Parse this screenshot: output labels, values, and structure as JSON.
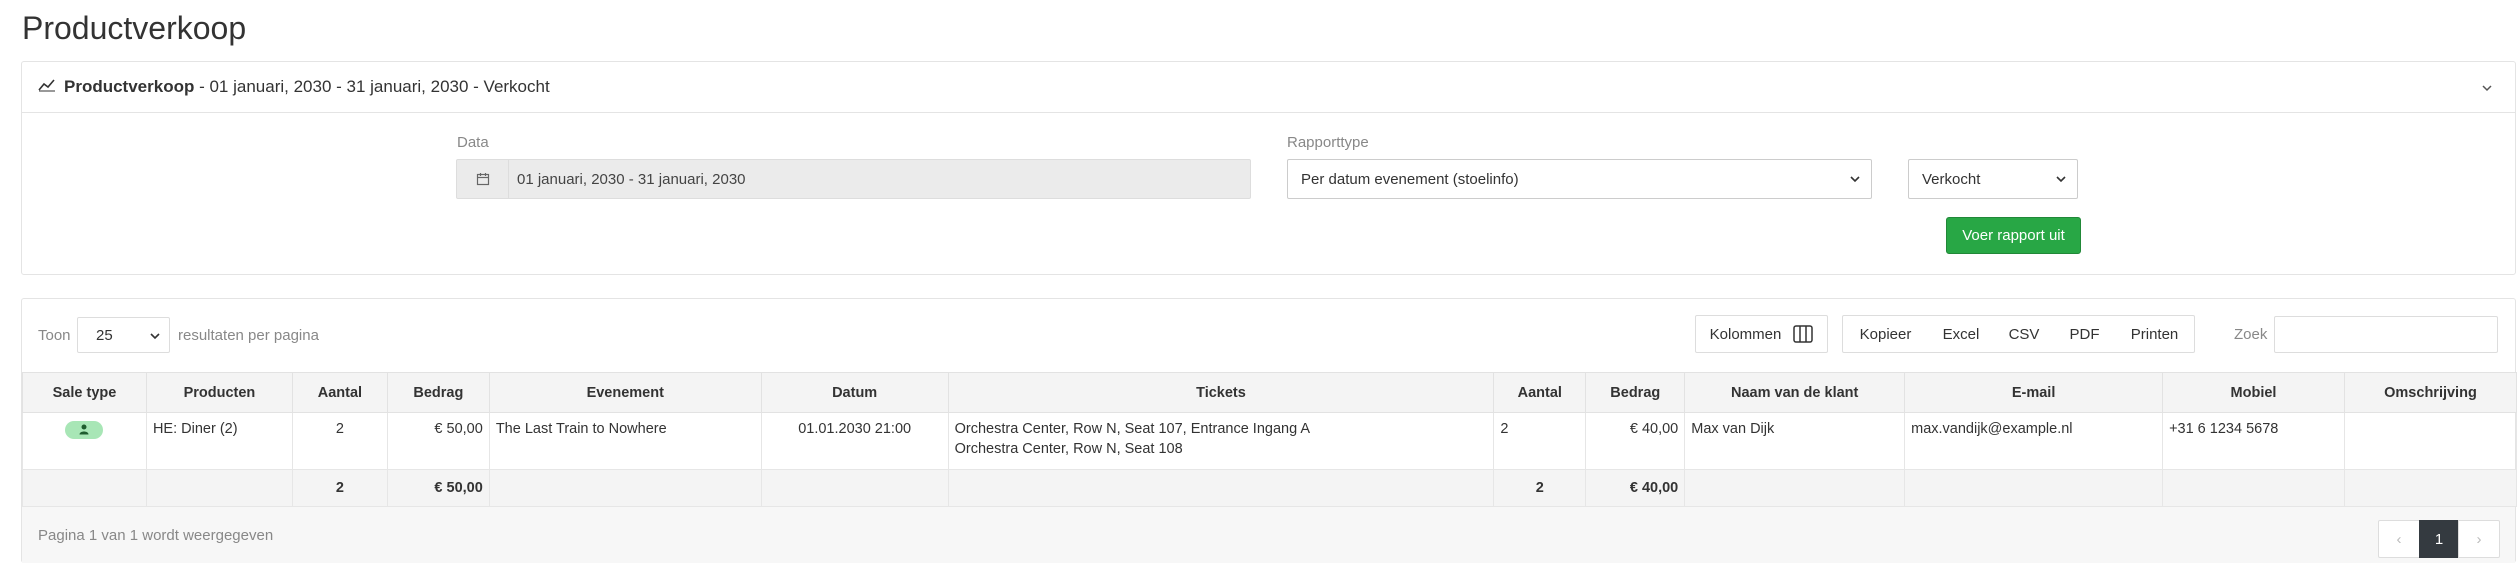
{
  "page": {
    "title": "Productverkoop"
  },
  "report": {
    "header_bold": "Productverkoop",
    "header_rest": " - 01 januari, 2030 - 31 januari, 2030 - Verkocht",
    "date_label": "Data",
    "date_value": "01 januari, 2030 - 31 januari, 2030",
    "type_label": "Rapporttype",
    "type_value": "Per datum evenement (stoelinfo)",
    "status_value": "Verkocht",
    "run_label": "Voer rapport uit"
  },
  "toolbar": {
    "show_label": "Toon",
    "page_length": "25",
    "per_page_label": "resultaten per pagina",
    "columns_label": "Kolommen",
    "copy_label": "Kopieer",
    "excel_label": "Excel",
    "csv_label": "CSV",
    "pdf_label": "PDF",
    "print_label": "Printen",
    "search_label": "Zoek"
  },
  "table": {
    "headers": [
      "Sale type",
      "Producten",
      "Aantal",
      "Bedrag",
      "Evenement",
      "Datum",
      "Tickets",
      "Aantal",
      "Bedrag",
      "Naam van de klant",
      "E-mail",
      "Mobiel",
      "Omschrijving"
    ],
    "rows": [
      {
        "producten": "HE: Diner (2)",
        "aantal": "2",
        "bedrag": "€ 50,00",
        "evenement": "The Last Train to Nowhere",
        "datum": "01.01.2030 21:00",
        "ticket_line1": "Orchestra Center, Row N, Seat 107, Entrance Ingang A",
        "ticket_line2": "Orchestra Center, Row N, Seat 108",
        "aantal2": "2",
        "bedrag2": "€ 40,00",
        "naam": "Max van Dijk",
        "email": "max.vandijk@example.nl",
        "mobiel": "+31 6 1234 5678",
        "omschrijving": ""
      }
    ],
    "totals": {
      "aantal": "2",
      "bedrag": "€ 50,00",
      "aantal2": "2",
      "bedrag2": "€ 40,00"
    }
  },
  "footer": {
    "info": "Pagina 1 van 1 wordt weergegeven",
    "prev": "‹",
    "page": "1",
    "next": "›"
  },
  "colors": {
    "accent_green": "#28a745",
    "badge_green": "#a8e6b6",
    "active_page": "#343a40"
  }
}
